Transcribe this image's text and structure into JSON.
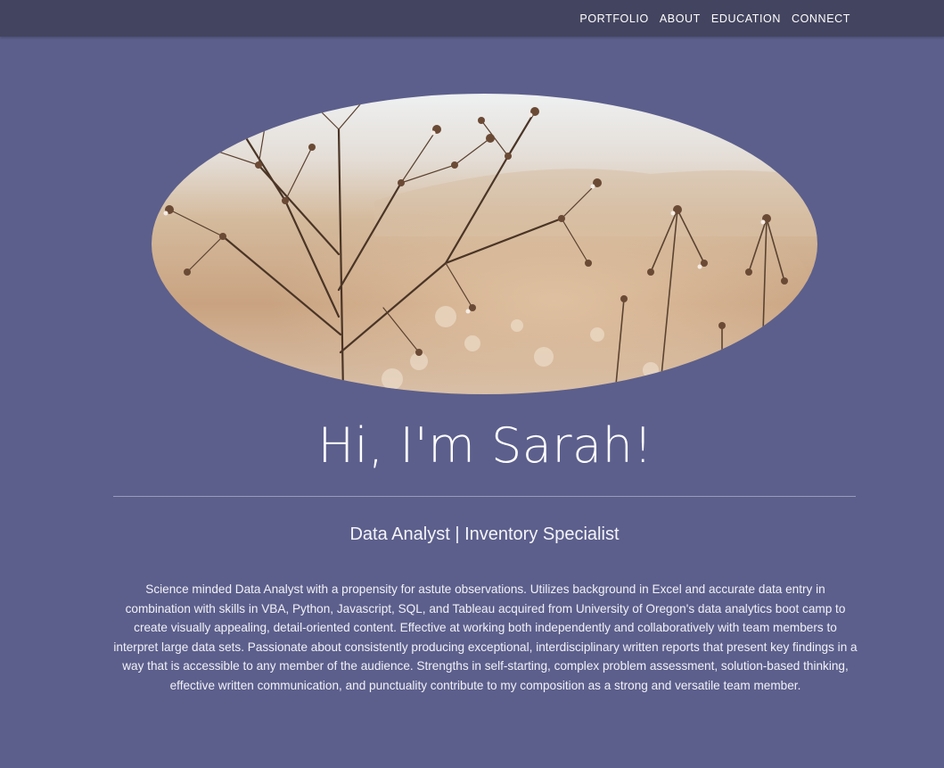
{
  "nav": {
    "items": [
      {
        "label": "PORTFOLIO"
      },
      {
        "label": "ABOUT"
      },
      {
        "label": "EDUCATION"
      },
      {
        "label": "CONNECT"
      }
    ]
  },
  "hero": {
    "greeting": "Hi, I'm Sarah!",
    "subtitle": "Data Analyst | Inventory Specialist",
    "bio": "Science minded Data Analyst with a propensity for astute observations. Utilizes background in Excel and accurate data entry in combination with skills in VBA, Python, Javascript, SQL, and Tableau acquired from University of Oregon's data analytics boot camp to create visually appealing, detail-oriented content. Effective at working both independently and collaboratively with team members to interpret large data sets. Passionate about consistently producing exceptional, interdisciplinary written reports that present key findings in a way that is accessible to any member of the audience. Strengths in self-starting, complex problem assessment, solution-based thinking, effective written communication, and punctuality contribute to my composition as a strong and versatile team member."
  },
  "colors": {
    "page_background": "#5c5f8c",
    "navbar_background": "#43445f",
    "text": "#ffffff"
  }
}
